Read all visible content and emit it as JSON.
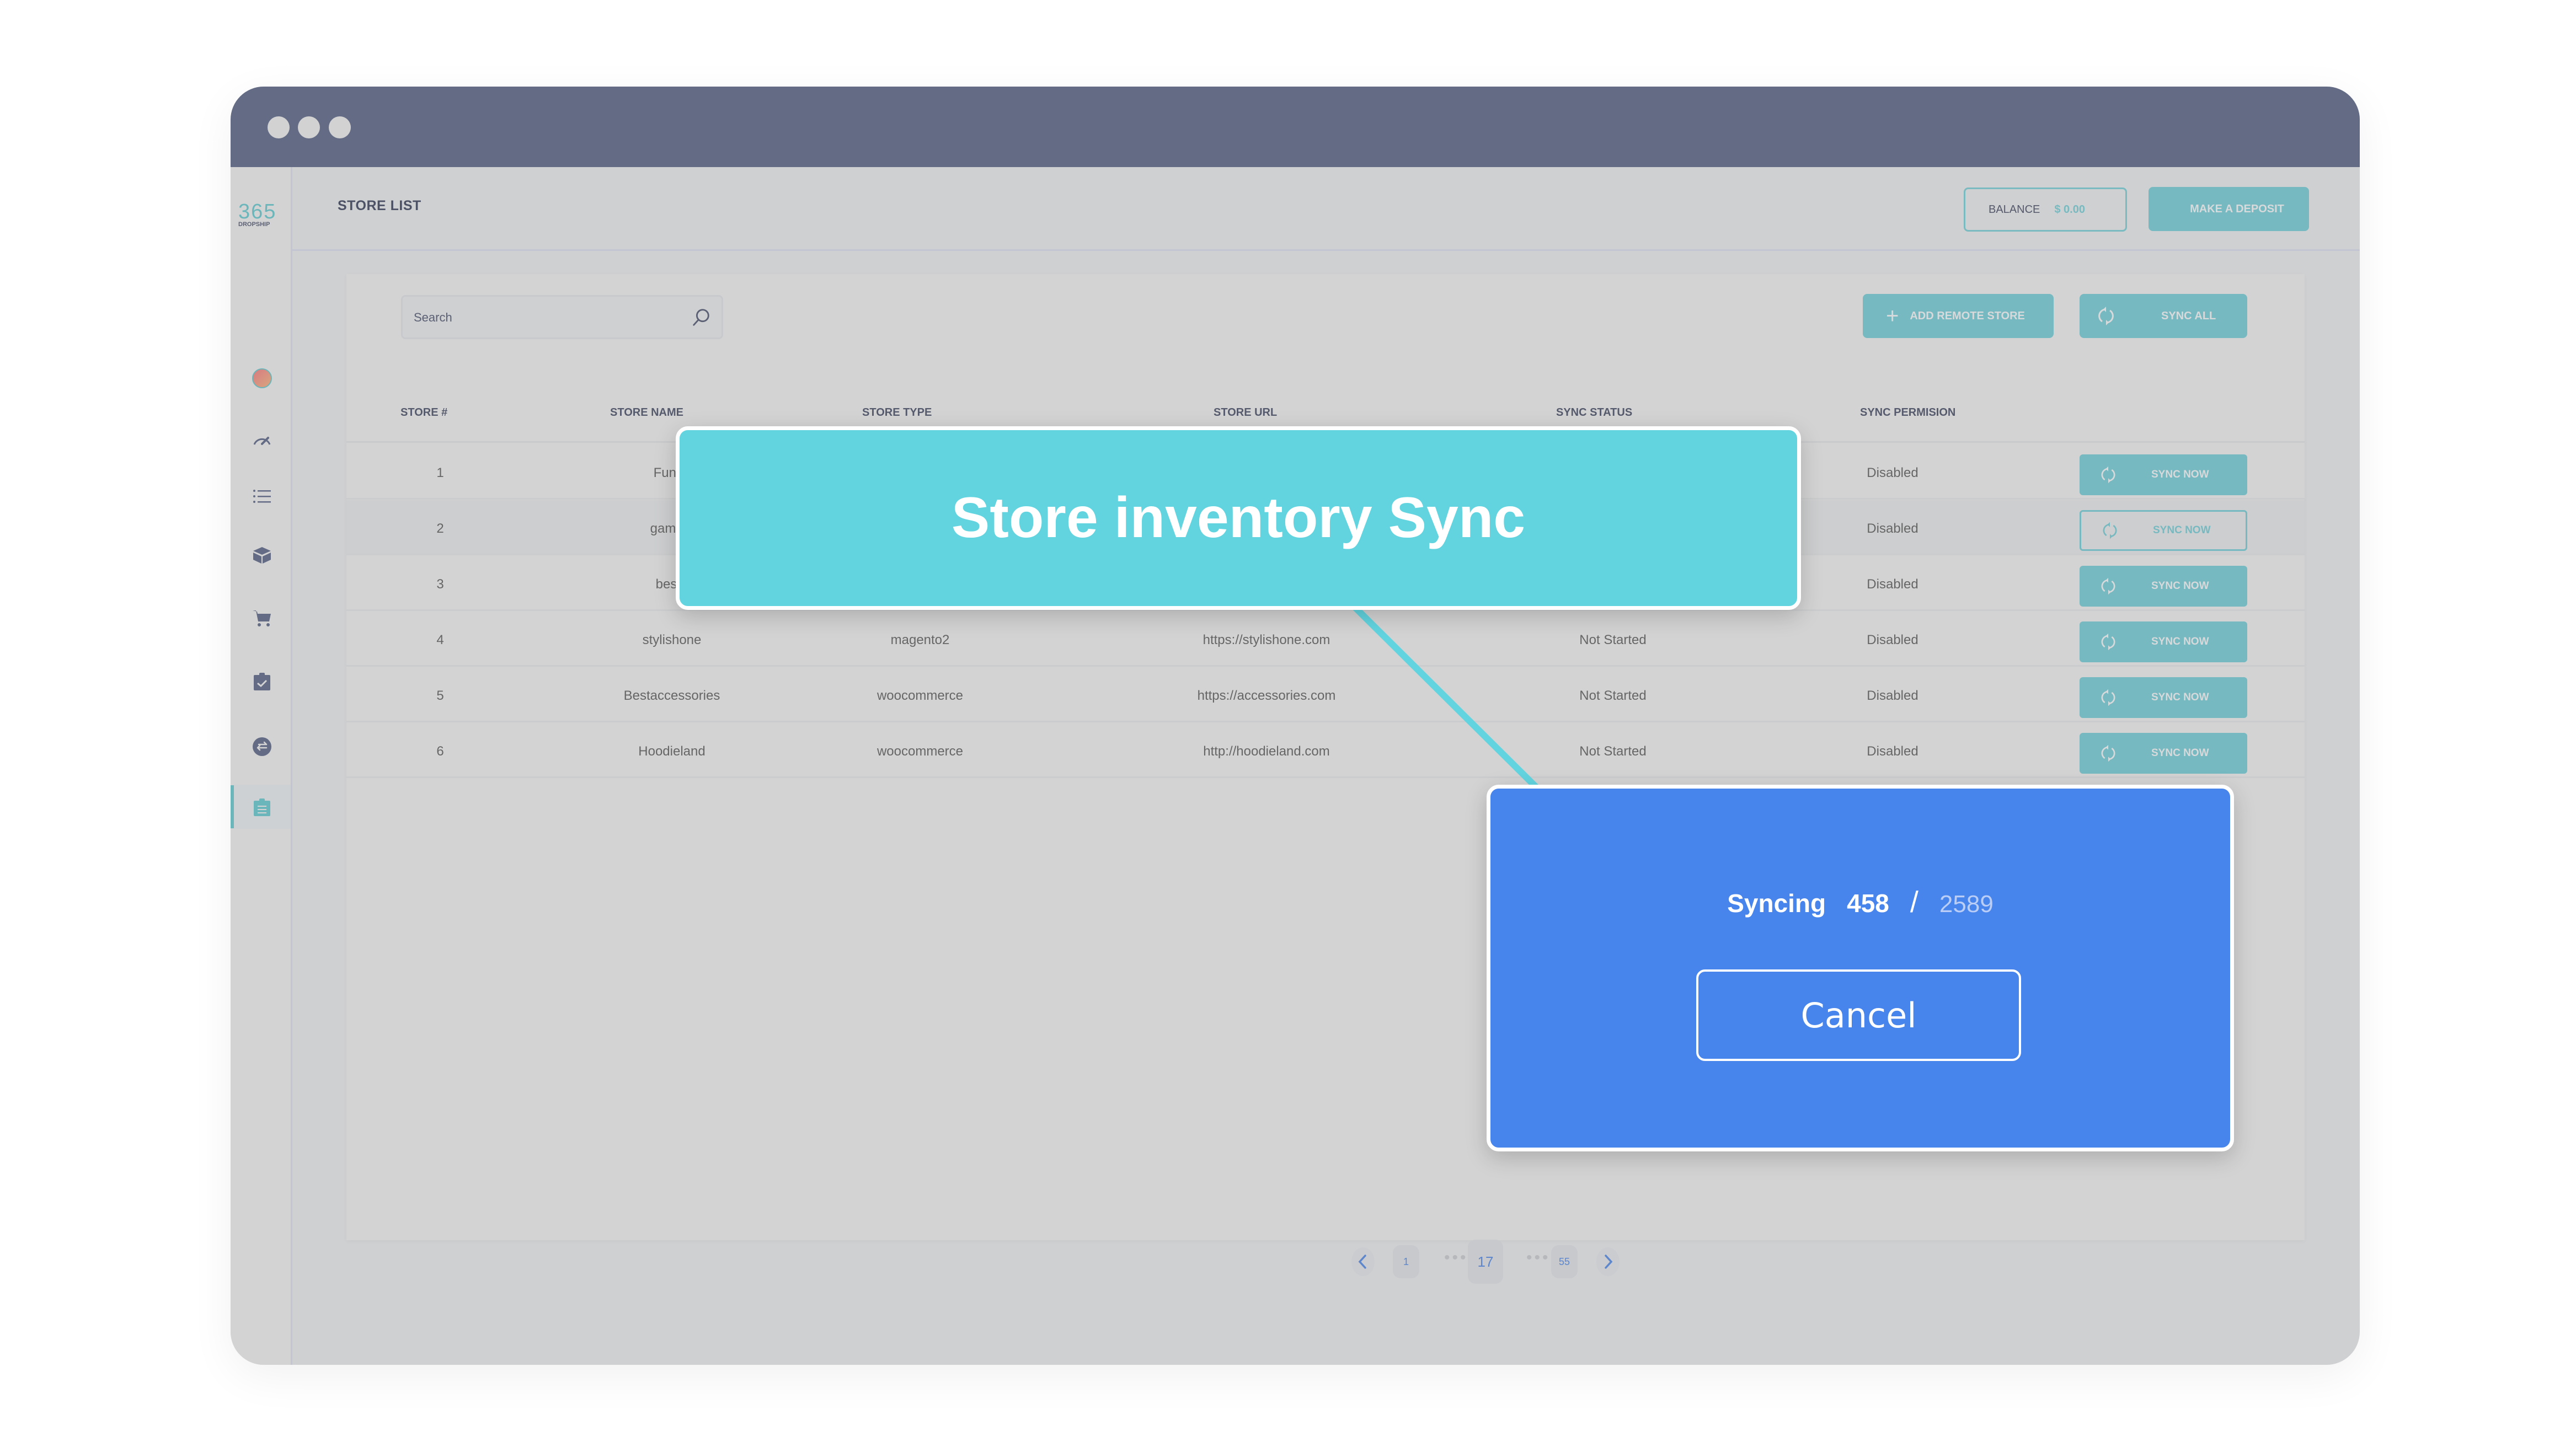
{
  "window": {
    "controls": [
      "close",
      "minimize",
      "maximize"
    ]
  },
  "brand": {
    "logo_number": "365",
    "logo_text": "DROPSHIP",
    "accent": "#6bb6ba"
  },
  "sidebar": {
    "items": [
      {
        "name": "avatar"
      },
      {
        "name": "dashboard-icon"
      },
      {
        "name": "list-icon"
      },
      {
        "name": "products-icon"
      },
      {
        "name": "cart-icon"
      },
      {
        "name": "orders-icon"
      },
      {
        "name": "transfer-icon"
      },
      {
        "name": "store-list-icon",
        "active": true
      }
    ],
    "footer": {
      "name": "settings-icon"
    }
  },
  "header": {
    "title": "STORE LIST",
    "balance_label": "BALANCE",
    "balance_value": "$  0.00",
    "deposit_label": "MAKE A DEPOSIT"
  },
  "toolbar": {
    "search_placeholder": "Search",
    "add_store_plus": "+",
    "add_store_label": "ADD REMOTE STORE",
    "sync_all_label": "SYNC ALL"
  },
  "table": {
    "columns": [
      "STORE #",
      "STORE NAME",
      "STORE TYPE",
      "STORE URL",
      "SYNC STATUS",
      "SYNC PERMISION"
    ],
    "rows": [
      {
        "num": "1",
        "name": "Funny",
        "type": "",
        "url": "",
        "status": "",
        "permission": "Disabled",
        "action": "SYNC NOW"
      },
      {
        "num": "2",
        "name": "gaming",
        "type": "",
        "url": "",
        "status": "",
        "permission": "Disabled",
        "action": "SYNC NOW"
      },
      {
        "num": "3",
        "name": "bestd",
        "type": "",
        "url": "",
        "status": "",
        "permission": "Disabled",
        "action": "SYNC NOW"
      },
      {
        "num": "4",
        "name": "stylishone",
        "type": "magento2",
        "url": "https://stylishone.com",
        "status": "Not Started",
        "permission": "Disabled",
        "action": "SYNC NOW"
      },
      {
        "num": "5",
        "name": "Bestaccessories",
        "type": "woocommerce",
        "url": "https://accessories.com",
        "status": "Not Started",
        "permission": "Disabled",
        "action": "SYNC NOW"
      },
      {
        "num": "6",
        "name": "Hoodieland",
        "type": "woocommerce",
        "url": "http://hoodieland.com",
        "status": "Not Started",
        "permission": "Disabled",
        "action": "SYNC NOW"
      }
    ]
  },
  "pagination": {
    "first": "1",
    "current": "17",
    "last": "55",
    "ellipsis": "•••"
  },
  "callout": {
    "title": "Store inventory Sync",
    "color": "#62d4df"
  },
  "sync_panel": {
    "label": "Syncing",
    "done": "458",
    "separator": "/",
    "total": "2589",
    "cancel_label": "Cancel",
    "color": "#4785ec"
  }
}
